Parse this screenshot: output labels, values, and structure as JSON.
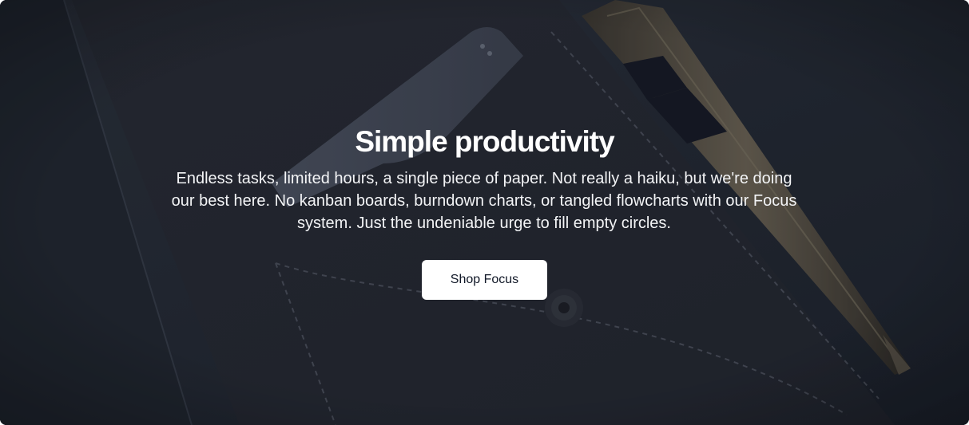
{
  "hero": {
    "title": "Simple productivity",
    "description": "Endless tasks, limited hours, a single piece of paper. Not really a haiku, but we're doing our best here. No kanban boards, burndown charts, or tangled flowcharts with our Focus system. Just the undeniable urge to fill empty circles.",
    "cta_label": "Shop Focus",
    "background_image": "felt-pouch-and-pen-photo",
    "colors": {
      "overlay": "#111827",
      "title": "#ffffff",
      "cta_background": "#ffffff",
      "cta_text": "#111827"
    }
  }
}
